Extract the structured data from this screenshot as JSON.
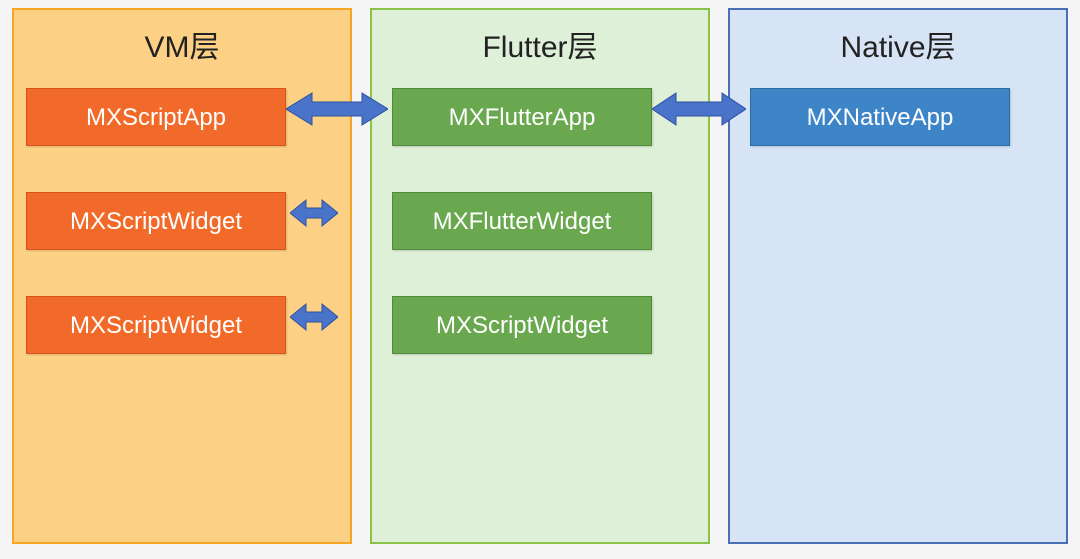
{
  "columns": {
    "vm": {
      "title": "VM层"
    },
    "flutter": {
      "title": "Flutter层"
    },
    "native": {
      "title": "Native层"
    }
  },
  "boxes": {
    "vm_r1": "MXScriptApp",
    "vm_r2": "MXScriptWidget",
    "vm_r3": "MXScriptWidget",
    "fl_r1": "MXFlutterApp",
    "fl_r2": "MXFlutterWidget",
    "fl_r3": "MXScriptWidget",
    "nv_r1": "MXNativeApp"
  },
  "colors": {
    "vm_bg": "#fdd185",
    "flutter_bg": "#dff0d8",
    "native_bg": "#d6e4f5",
    "box_orange": "#f26a2a",
    "box_green": "#6aa84f",
    "box_blue": "#3d85c6",
    "arrow": "#4a74c9"
  },
  "arrows": [
    {
      "from": "vm_r1",
      "to": "fl_r1",
      "size": "large"
    },
    {
      "from": "fl_r1",
      "to": "nv_r1",
      "size": "large"
    },
    {
      "from": "vm_r2",
      "to": "fl_r2",
      "size": "small"
    },
    {
      "from": "vm_r3",
      "to": "fl_r3",
      "size": "small"
    }
  ]
}
